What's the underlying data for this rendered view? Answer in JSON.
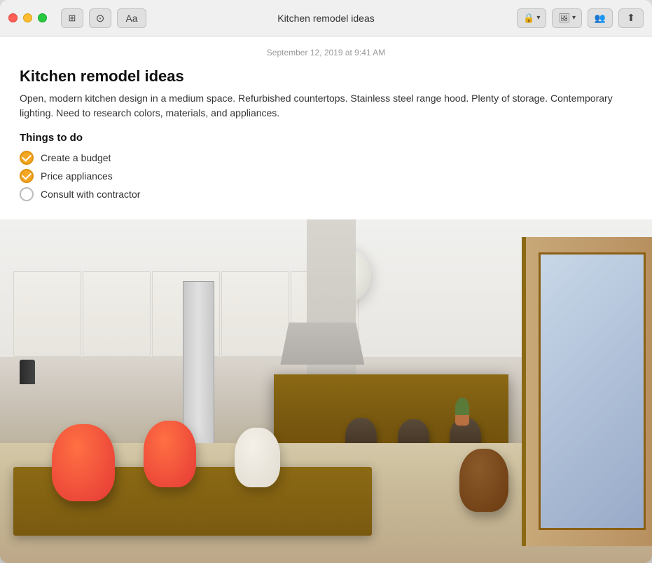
{
  "window": {
    "title": "Kitchen remodel ideas"
  },
  "titlebar": {
    "traffic_lights": [
      "close",
      "minimize",
      "maximize"
    ],
    "tools": [
      {
        "name": "grid-icon",
        "label": "⊞"
      },
      {
        "name": "check-icon",
        "label": "✓"
      },
      {
        "name": "font-icon",
        "label": "Aa"
      }
    ],
    "right_controls": [
      {
        "name": "lock-btn",
        "label": "🔒 ▾"
      },
      {
        "name": "photo-btn",
        "label": "🖼 ▾"
      },
      {
        "name": "share-people-btn",
        "label": "👥"
      },
      {
        "name": "share-btn",
        "label": "↑"
      }
    ]
  },
  "note": {
    "date": "September 12, 2019 at 9:41 AM",
    "title": "Kitchen remodel ideas",
    "body": "Open, modern kitchen design in a medium space. Refurbished countertops. Stainless steel range hood. Plenty of storage. Contemporary lighting. Need to research colors, materials, and appliances.",
    "section_heading": "Things to do",
    "checklist": [
      {
        "text": "Create a budget",
        "checked": true
      },
      {
        "text": "Price appliances",
        "checked": true
      },
      {
        "text": "Consult with contractor",
        "checked": false
      }
    ]
  }
}
